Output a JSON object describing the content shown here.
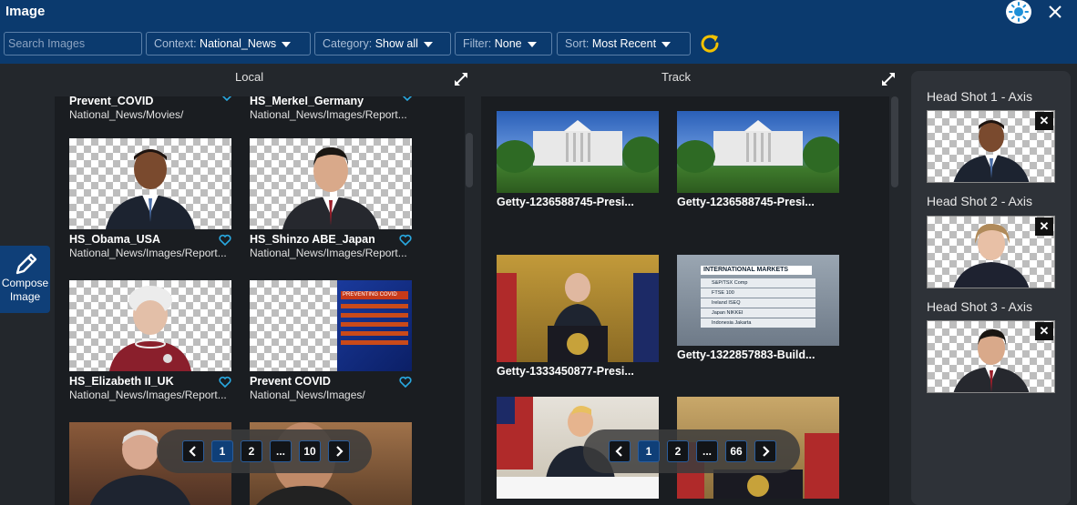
{
  "window": {
    "title": "Image"
  },
  "toolbar": {
    "search_placeholder": "Search Images",
    "context": {
      "label": "Context:",
      "value": "National_News"
    },
    "category": {
      "label": "Category:",
      "value": "Show all"
    },
    "filter": {
      "label": "Filter:",
      "value": "None"
    },
    "sort": {
      "label": "Sort:",
      "value": "Most Recent"
    }
  },
  "compose": {
    "line1": "Compose",
    "line2": "Image"
  },
  "local": {
    "title": "Local",
    "items": [
      {
        "name": "Prevent_COVID",
        "path": "National_News/Movies/"
      },
      {
        "name": "HS_Merkel_Germany",
        "path": "National_News/Images/Report..."
      },
      {
        "name": "HS_Obama_USA",
        "path": "National_News/Images/Report..."
      },
      {
        "name": "HS_Shinzo ABE_Japan",
        "path": "National_News/Images/Report..."
      },
      {
        "name": "HS_Elizabeth II_UK",
        "path": "National_News/Images/Report..."
      },
      {
        "name": "Prevent COVID",
        "path": "National_News/Images/"
      }
    ],
    "covid_thumb": {
      "title": "PREVENTING COVID"
    },
    "pager": {
      "pages": [
        "1",
        "2",
        "...",
        "10"
      ],
      "active": "1"
    }
  },
  "track": {
    "title": "Track",
    "items": [
      {
        "name": "Getty-1236588745-Presi..."
      },
      {
        "name": "Getty-1236588745-Presi..."
      },
      {
        "name": "Getty-1333450877-Presi..."
      },
      {
        "name": "Getty-1322857883-Build..."
      }
    ],
    "markets_thumb": {
      "title": "INTERNATIONAL MARKETS",
      "rows": [
        "S&P/TSX Comp",
        "FTSE 100",
        "Ireland ISEQ",
        "Japan NIKKEI",
        "Indonesia Jakarta"
      ]
    },
    "pager": {
      "pages": [
        "1",
        "2",
        "...",
        "66"
      ],
      "active": "1"
    }
  },
  "headshots": [
    {
      "label": "Head Shot 1 - Axis",
      "remove": "✕"
    },
    {
      "label": "Head Shot 2 - Axis",
      "remove": "✕"
    },
    {
      "label": "Head Shot 3 - Axis",
      "remove": "✕"
    }
  ],
  "colors": {
    "accent": "#0b3a6e",
    "heart": "#29a8e0",
    "refresh": "#f2c200"
  }
}
